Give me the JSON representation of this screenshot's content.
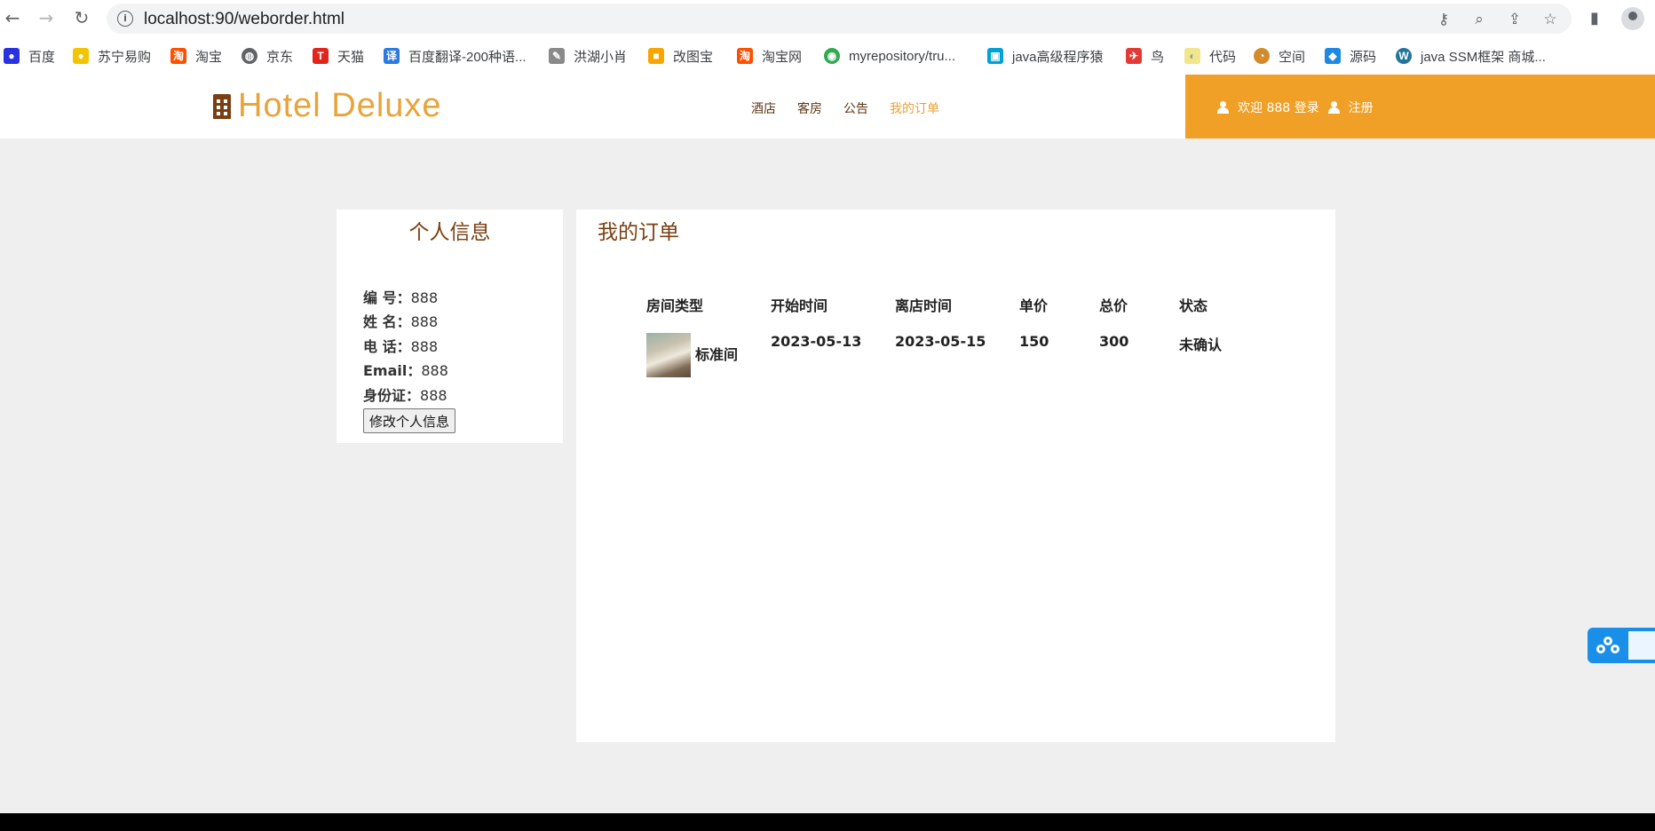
{
  "browser": {
    "url": "localhost:90/weborder.html",
    "bookmarks": [
      {
        "label": "百度",
        "color": "#2932e1"
      },
      {
        "label": "苏宁易购",
        "color": "#f5c400"
      },
      {
        "label": "淘宝",
        "color": "#ff5000"
      },
      {
        "label": "京东",
        "color": "#5f6368"
      },
      {
        "label": "天猫",
        "color": "#e1251b"
      },
      {
        "label": "百度翻译-200种语...",
        "color": "#2a7ae2"
      },
      {
        "label": "洪湖小肖",
        "color": "#8a8a8a"
      },
      {
        "label": "改图宝",
        "color": "#f7a600"
      },
      {
        "label": "淘宝网",
        "color": "#ff5000"
      },
      {
        "label": "myrepository/tru...",
        "color": "#34a853"
      },
      {
        "label": "java高级程序猿",
        "color": "#00a1d6"
      },
      {
        "label": "鸟",
        "color": "#e53935"
      },
      {
        "label": "代码",
        "color": "#f0e68c"
      },
      {
        "label": "空间",
        "color": "#d18b2c"
      },
      {
        "label": "源码",
        "color": "#1e88e5"
      },
      {
        "label": "java SSM框架 商城...",
        "color": "#21759b"
      }
    ]
  },
  "site": {
    "logo": "Hotel Deluxe",
    "nav": [
      "酒店",
      "客房",
      "公告",
      "我的订单"
    ],
    "nav_active": "我的订单",
    "welcome": "欢迎 888 登录",
    "register": "注册",
    "accent": "#f0a026"
  },
  "profile": {
    "title": "个人信息",
    "fields": [
      {
        "label": "编  号：",
        "value": "888"
      },
      {
        "label": "姓  名：",
        "value": "888"
      },
      {
        "label": "电  话：",
        "value": "888"
      },
      {
        "label": "Email：",
        "value": "888"
      },
      {
        "label": "身份证：",
        "value": "888"
      }
    ],
    "edit_button": "修改个人信息"
  },
  "orders": {
    "title": "我的订单",
    "columns": [
      "房间类型",
      "开始时间",
      "离店时间",
      "单价",
      "总价",
      "状态"
    ],
    "rows": [
      {
        "room_type": "标准间",
        "start": "2023-05-13",
        "end": "2023-05-15",
        "unit_price": "150",
        "total": "300",
        "status": "未确认"
      }
    ]
  }
}
